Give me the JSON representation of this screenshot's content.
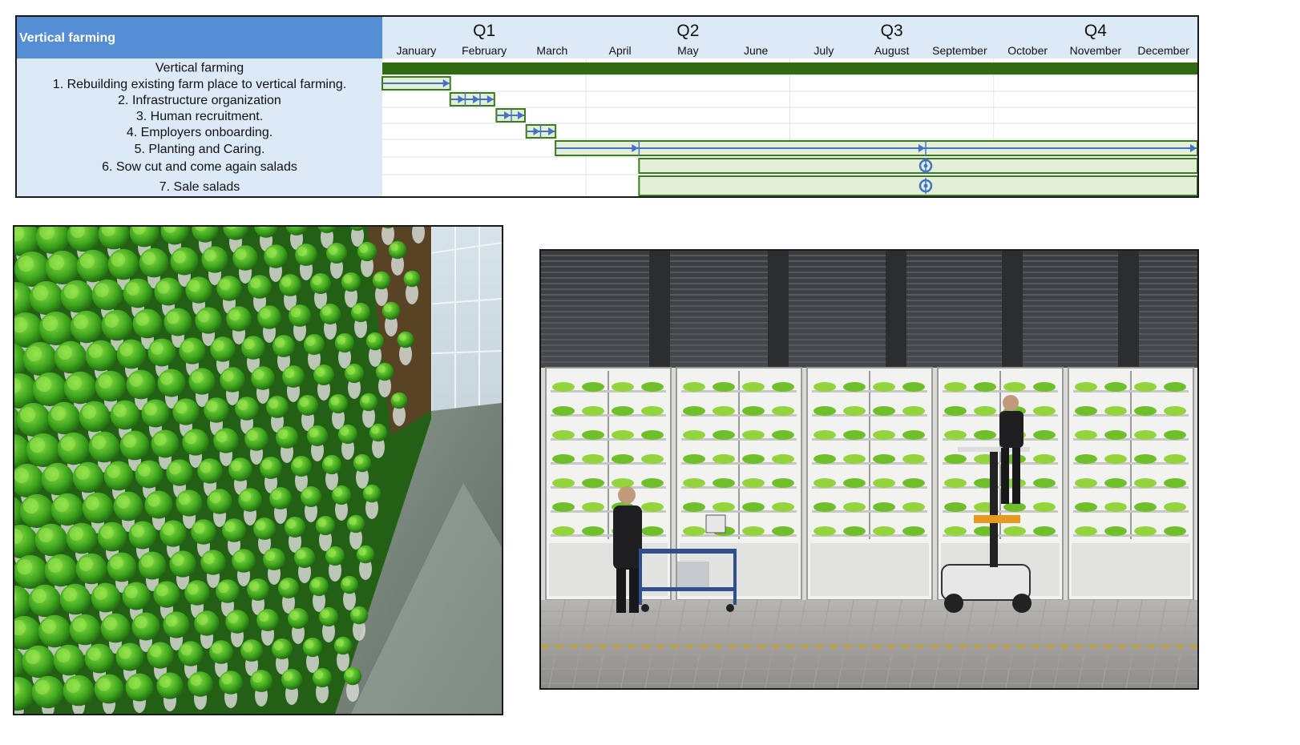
{
  "header": {
    "title": "Vertical farming"
  },
  "quarters": [
    "Q1",
    "Q2",
    "Q3",
    "Q4"
  ],
  "months": [
    "January",
    "February",
    "March",
    "April",
    "May",
    "June",
    "July",
    "August",
    "September",
    "October",
    "November",
    "December"
  ],
  "summary_task": "Vertical farming",
  "tasks": [
    {
      "label": "1. Rebuilding existing farm place to vertical farming.",
      "start": 0.0,
      "end": 1.0,
      "arrows": [
        1.0
      ]
    },
    {
      "label": "2. Infrastructure organization",
      "start": 1.0,
      "end": 1.65,
      "arrows": [
        1.22,
        1.44,
        1.65
      ]
    },
    {
      "label": "3. Human recruitment.",
      "start": 1.68,
      "end": 2.1,
      "arrows": [
        1.9,
        2.1
      ]
    },
    {
      "label": "4. Employers onboarding.",
      "start": 2.12,
      "end": 2.55,
      "arrows": [
        2.33,
        2.55
      ]
    },
    {
      "label": "5. Planting and Caring.",
      "start": 2.55,
      "end": 12.0,
      "arrows": [
        3.78,
        8.0,
        12.0
      ]
    },
    {
      "label": "6. Sow cut and come again salads",
      "start": 3.78,
      "end": 12.0,
      "recurring_at": 8.0
    },
    {
      "label": "7. Sale salads",
      "start": 3.78,
      "end": 12.0,
      "recurring_at": 8.0
    }
  ],
  "colors": {
    "header_bg": "#558ed5",
    "label_bg": "#dce9f6",
    "summary_bar": "#2e6b12",
    "task_fill": "#e4efd9",
    "task_border": "#3e7a1e",
    "arrow": "#4472c4"
  },
  "images": [
    {
      "subject": "vertical-lettuce-wall-greenhouse"
    },
    {
      "subject": "indoor-vertical-farm-cabinets-with-workers"
    }
  ]
}
